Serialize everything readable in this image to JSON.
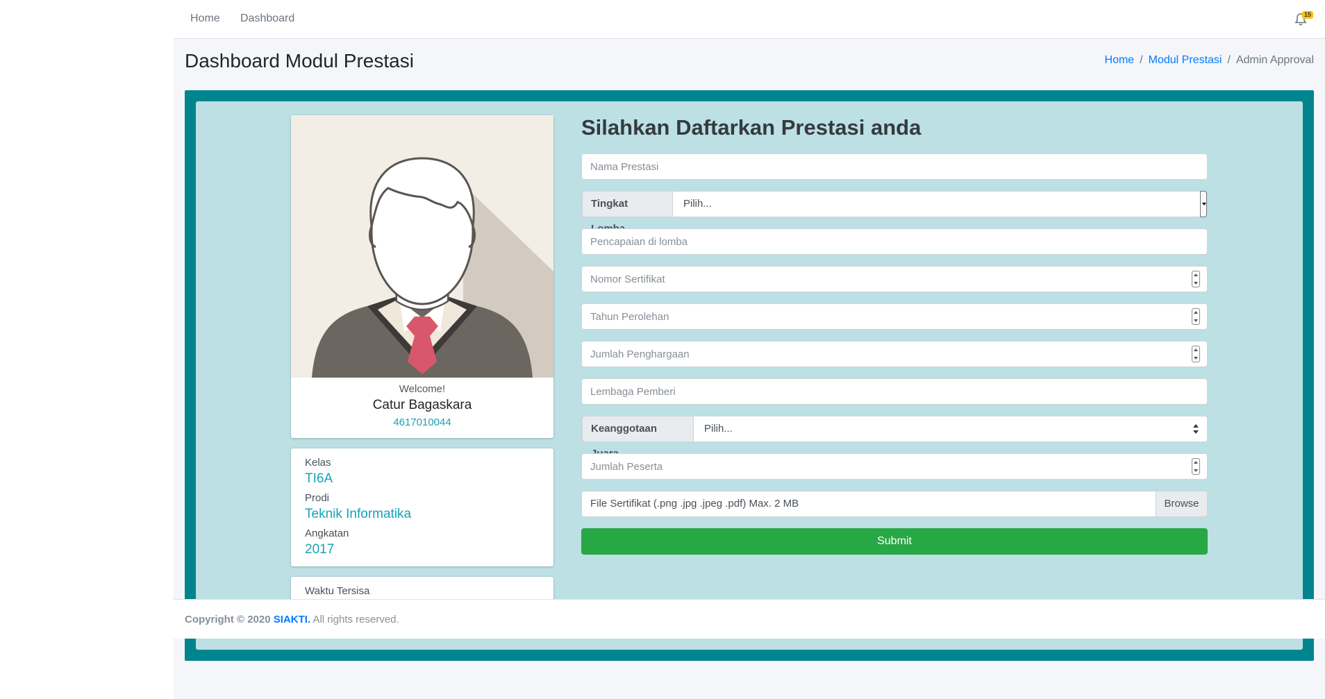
{
  "nav": {
    "links": [
      "Home",
      "Dashboard"
    ],
    "notification_count": "15"
  },
  "page": {
    "title": "Dashboard Modul Prestasi",
    "breadcrumb": [
      "Home",
      "Modul Prestasi",
      "Admin Approval"
    ]
  },
  "profile": {
    "welcome": "Welcome!",
    "name": "Catur Bagaskara",
    "nim": "4617010044"
  },
  "info": {
    "kelas_label": "Kelas",
    "kelas_value": "TI6A",
    "prodi_label": "Prodi",
    "prodi_value": "Teknik Informatika",
    "angkatan_label": "Angkatan",
    "angkatan_value": "2017",
    "waktu_label": "Waktu Tersisa"
  },
  "form": {
    "title": "Silahkan Daftarkan Prestasi anda",
    "nama_prestasi_placeholder": "Nama Prestasi",
    "tingkat_label": "Tingkat Lomba",
    "tingkat_value": "Pilih...",
    "pencapaian_placeholder": "Pencapaian di lomba",
    "nomor_placeholder": "Nomor Sertifikat",
    "tahun_placeholder": "Tahun Perolehan",
    "jumlah_penghargaan_placeholder": "Jumlah Penghargaan",
    "lembaga_placeholder": "Lembaga Pemberi",
    "keanggotaan_label": "Keanggotaan Juara",
    "keanggotaan_value": "Pilih...",
    "jumlah_peserta_placeholder": "Jumlah Peserta",
    "file_label": "File Sertifikat (.png .jpg .jpeg .pdf) Max. 2 MB",
    "browse_label": "Browse",
    "submit_label": "Submit"
  },
  "footer": {
    "copyright": "Copyright © 2020",
    "brand": "SIAKTI.",
    "rights": "All rights reserved."
  },
  "colors": {
    "outer_card": "#00858f",
    "inner_card": "#bce0e4",
    "submit": "#28a745",
    "link": "#007bff",
    "info_value": "#17a2b8"
  }
}
